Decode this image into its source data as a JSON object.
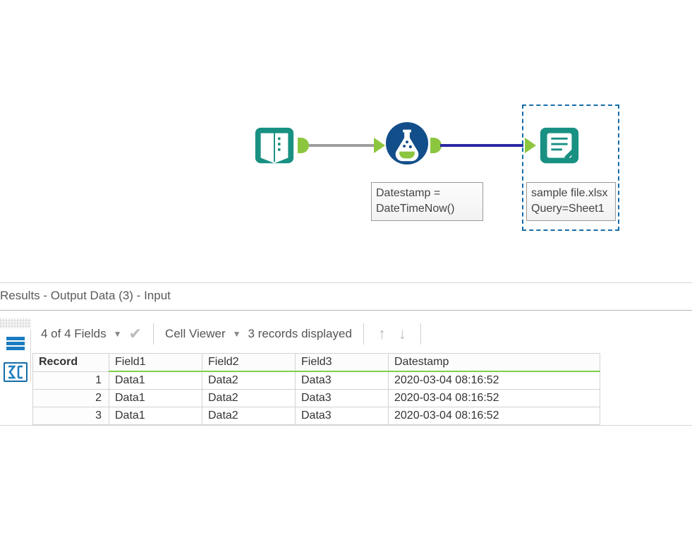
{
  "canvas": {
    "formula_label_line1": "Datestamp =",
    "formula_label_line2": "DateTimeNow()",
    "output_label_line1": "sample file.xlsx",
    "output_label_line2": "Query=Sheet1"
  },
  "results": {
    "title": "Results - Output Data (3) - Input",
    "fields_summary": "4 of 4 Fields",
    "cell_viewer_label": "Cell Viewer",
    "records_summary": "3 records displayed",
    "columns": {
      "record": "Record",
      "field1": "Field1",
      "field2": "Field2",
      "field3": "Field3",
      "datestamp": "Datestamp"
    },
    "rows": [
      {
        "n": "1",
        "f1": "Data1",
        "f2": "Data2",
        "f3": "Data3",
        "ds": "2020-03-04 08:16:52"
      },
      {
        "n": "2",
        "f1": "Data1",
        "f2": "Data2",
        "f3": "Data3",
        "ds": "2020-03-04 08:16:52"
      },
      {
        "n": "3",
        "f1": "Data1",
        "f2": "Data2",
        "f3": "Data3",
        "ds": "2020-03-04 08:16:52"
      }
    ]
  }
}
